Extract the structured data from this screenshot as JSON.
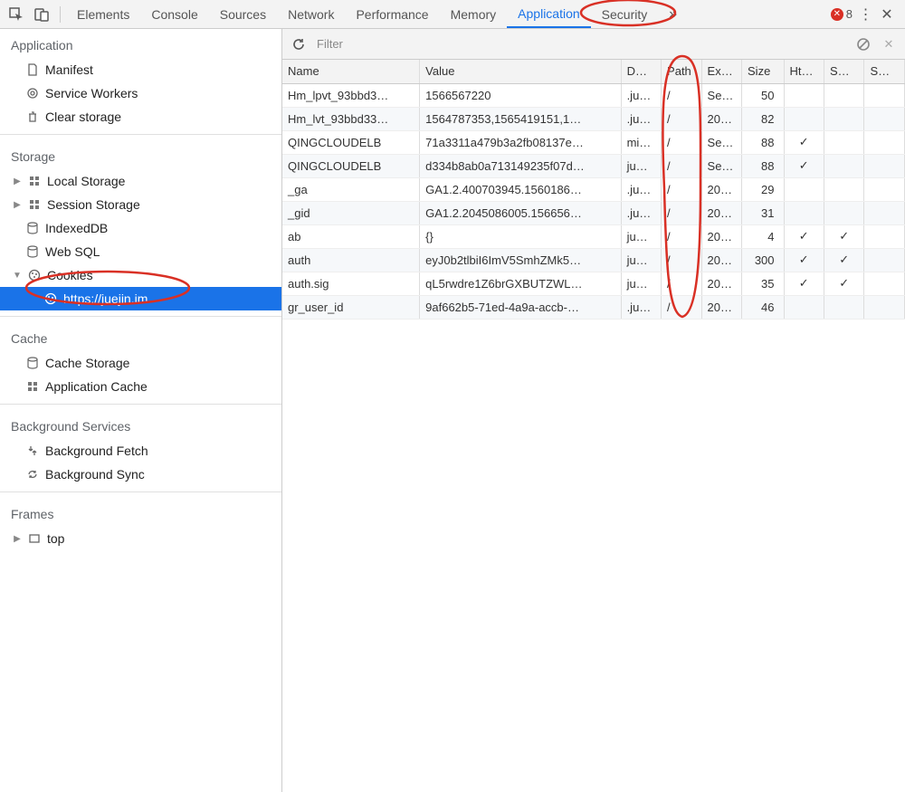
{
  "toolbar": {
    "tabs": [
      "Elements",
      "Console",
      "Sources",
      "Network",
      "Performance",
      "Memory",
      "Application",
      "Security"
    ],
    "active_tab": "Application",
    "overflow_glyph": "»",
    "error_count": "8"
  },
  "sidebar": {
    "sections": {
      "application": {
        "title": "Application",
        "items": [
          "Manifest",
          "Service Workers",
          "Clear storage"
        ]
      },
      "storage": {
        "title": "Storage",
        "items": [
          "Local Storage",
          "Session Storage",
          "IndexedDB",
          "Web SQL",
          "Cookies"
        ],
        "cookies_children": [
          "https://juejin.im"
        ]
      },
      "cache": {
        "title": "Cache",
        "items": [
          "Cache Storage",
          "Application Cache"
        ]
      },
      "background": {
        "title": "Background Services",
        "items": [
          "Background Fetch",
          "Background Sync"
        ]
      },
      "frames": {
        "title": "Frames",
        "items": [
          "top"
        ]
      }
    }
  },
  "filter": {
    "placeholder": "Filter"
  },
  "columns": [
    "Name",
    "Value",
    "D…",
    "Path",
    "Ex…",
    "Size",
    "Ht…",
    "S…",
    "S…"
  ],
  "cookies": [
    {
      "name": "Hm_lpvt_93bbd3…",
      "value": "1566567220",
      "domain": ".ju…",
      "path": "/",
      "expires": "Se…",
      "size": "50",
      "http": "",
      "secure": "",
      "same": ""
    },
    {
      "name": "Hm_lvt_93bbd33…",
      "value": "1564787353,1565419151,1…",
      "domain": ".ju…",
      "path": "/",
      "expires": "20…",
      "size": "82",
      "http": "",
      "secure": "",
      "same": ""
    },
    {
      "name": "QINGCLOUDELB",
      "value": "71a3311a479b3a2fb08137e…",
      "domain": "mi…",
      "path": "/",
      "expires": "Se…",
      "size": "88",
      "http": "✓",
      "secure": "",
      "same": ""
    },
    {
      "name": "QINGCLOUDELB",
      "value": "d334b8ab0a713149235f07d…",
      "domain": "ju…",
      "path": "/",
      "expires": "Se…",
      "size": "88",
      "http": "✓",
      "secure": "",
      "same": ""
    },
    {
      "name": "_ga",
      "value": "GA1.2.400703945.1560186…",
      "domain": ".ju…",
      "path": "/",
      "expires": "20…",
      "size": "29",
      "http": "",
      "secure": "",
      "same": ""
    },
    {
      "name": "_gid",
      "value": "GA1.2.2045086005.156656…",
      "domain": ".ju…",
      "path": "/",
      "expires": "20…",
      "size": "31",
      "http": "",
      "secure": "",
      "same": ""
    },
    {
      "name": "ab",
      "value": "{}",
      "domain": "ju…",
      "path": "/",
      "expires": "20…",
      "size": "4",
      "http": "✓",
      "secure": "✓",
      "same": ""
    },
    {
      "name": "auth",
      "value": "eyJ0b2tlbiI6ImV5SmhZMk5…",
      "domain": "ju…",
      "path": "/",
      "expires": "20…",
      "size": "300",
      "http": "✓",
      "secure": "✓",
      "same": ""
    },
    {
      "name": "auth.sig",
      "value": "qL5rwdre1Z6brGXBUTZWL…",
      "domain": "ju…",
      "path": "/",
      "expires": "20…",
      "size": "35",
      "http": "✓",
      "secure": "✓",
      "same": ""
    },
    {
      "name": "gr_user_id",
      "value": "9af662b5-71ed-4a9a-accb-…",
      "domain": ".ju…",
      "path": "/",
      "expires": "20…",
      "size": "46",
      "http": "",
      "secure": "",
      "same": ""
    }
  ]
}
